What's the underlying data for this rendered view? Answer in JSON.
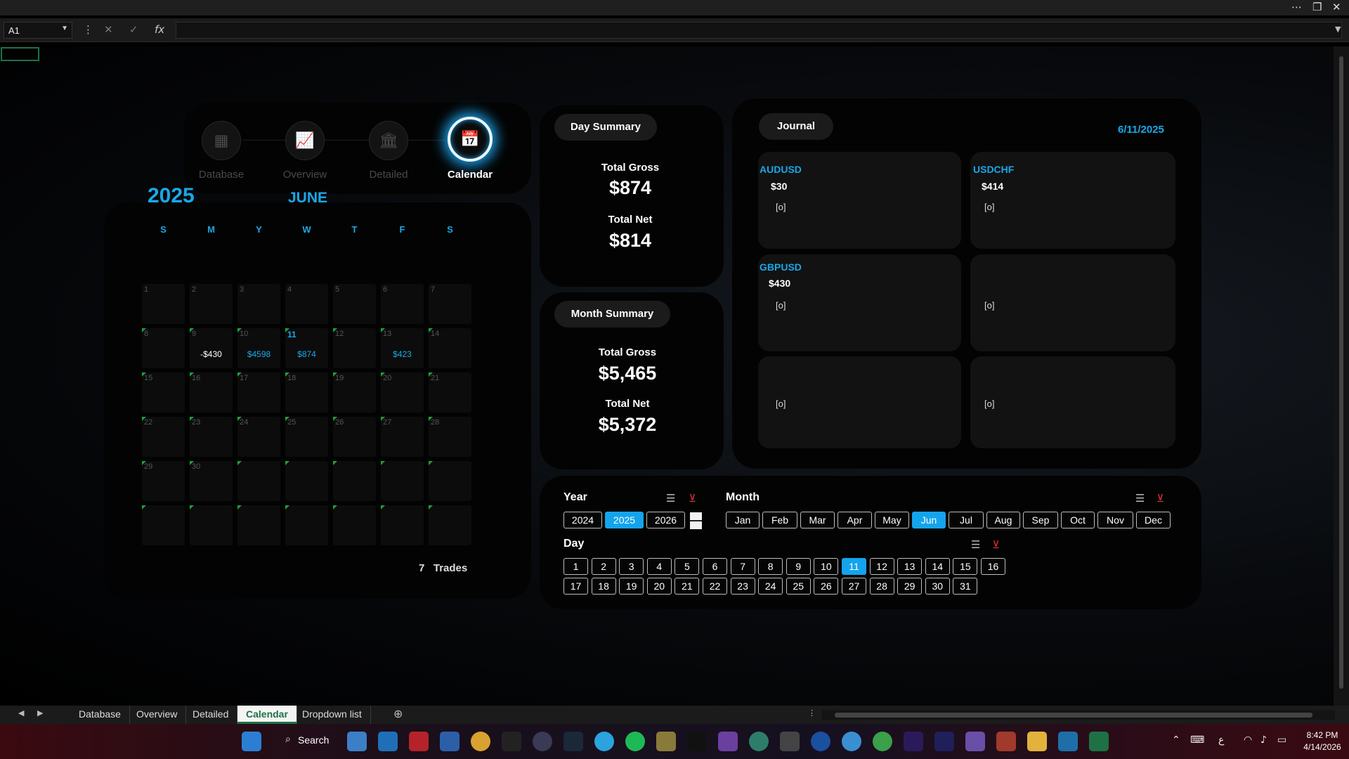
{
  "excel": {
    "name_box": "A1",
    "formula_value": "",
    "colors": {
      "accent": "#1aa8e8",
      "slicer_selected": "#14a4ec",
      "excel_green": "#1e7145"
    }
  },
  "nav": {
    "items": [
      {
        "label": "Database",
        "icon": "grid-icon",
        "active": false
      },
      {
        "label": "Overview",
        "icon": "chart-icon",
        "active": false
      },
      {
        "label": "Detailed",
        "icon": "building-icon",
        "active": false
      },
      {
        "label": "Calendar",
        "icon": "calendar-icon",
        "active": true
      }
    ]
  },
  "calendar": {
    "year": "2025",
    "month": "JUNE",
    "weekdays": [
      "S",
      "M",
      "Y",
      "W",
      "T",
      "F",
      "S"
    ],
    "cells": [
      "1",
      "2",
      "3",
      "4",
      "5",
      "6",
      "7",
      "8",
      "9",
      "10",
      "11",
      "12",
      "13",
      "14",
      "15",
      "16",
      "17",
      "18",
      "19",
      "20",
      "21",
      "22",
      "23",
      "24",
      "25",
      "26",
      "27",
      "28",
      "29",
      "30",
      "",
      "",
      "",
      "",
      "",
      "",
      "",
      "",
      "",
      "",
      "",
      ""
    ],
    "values": [
      "",
      "",
      "",
      "",
      "",
      "",
      "",
      "",
      "-$430",
      "$4598",
      "$874",
      "",
      "$423",
      "",
      "",
      "",
      "",
      "",
      "",
      "",
      "",
      "",
      "",
      "",
      "",
      "",
      "",
      "",
      "",
      "",
      "",
      "",
      "",
      "",
      "",
      "",
      "",
      "",
      "",
      "",
      "",
      ""
    ],
    "highlighted_cell_index": 10,
    "trade_count": "7",
    "trades_label": "Trades"
  },
  "day_summary": {
    "title": "Day Summary",
    "gross_label": "Total Gross",
    "gross_value": "$874",
    "net_label": "Total Net",
    "net_value": "$814"
  },
  "month_summary": {
    "title": "Month Summary",
    "gross_label": "Total Gross",
    "gross_value": "$5,465",
    "net_label": "Total Net",
    "net_value": "$5,372"
  },
  "journal": {
    "title": "Journal",
    "date": "6/11/2025",
    "entries": [
      {
        "pair": "AUDUSD",
        "amount": "$30",
        "note": "[o]"
      },
      {
        "pair": "USDCHF",
        "amount": "$414",
        "note": "[o]"
      },
      {
        "pair": "GBPUSD",
        "amount": "$430",
        "note": "[o]"
      },
      {
        "pair": "",
        "amount": "",
        "note": "[o]"
      },
      {
        "pair": "",
        "amount": "",
        "note": "[o]"
      },
      {
        "pair": "",
        "amount": "",
        "note": "[o]"
      }
    ]
  },
  "slicers": {
    "year": {
      "title": "Year",
      "options": [
        "2024",
        "2025",
        "2026"
      ],
      "selected": "2025"
    },
    "month": {
      "title": "Month",
      "options": [
        "Jan",
        "Feb",
        "Mar",
        "Apr",
        "May",
        "Jun",
        "Jul",
        "Aug",
        "Sep",
        "Oct",
        "Nov",
        "Dec"
      ],
      "selected": "Jun"
    },
    "day": {
      "title": "Day",
      "options": [
        "1",
        "2",
        "3",
        "4",
        "5",
        "6",
        "7",
        "8",
        "9",
        "10",
        "11",
        "12",
        "13",
        "14",
        "15",
        "16",
        "17",
        "18",
        "19",
        "20",
        "21",
        "22",
        "23",
        "24",
        "25",
        "26",
        "27",
        "28",
        "29",
        "30",
        "31"
      ],
      "selected": "11"
    }
  },
  "sheet_tabs": {
    "tabs": [
      "Database",
      "Overview",
      "Detailed",
      "Calendar",
      "Dropdown list"
    ],
    "active": "Calendar"
  },
  "taskbar": {
    "search_label": "Search",
    "time": "8:42 PM",
    "date": "4/14/2026"
  }
}
